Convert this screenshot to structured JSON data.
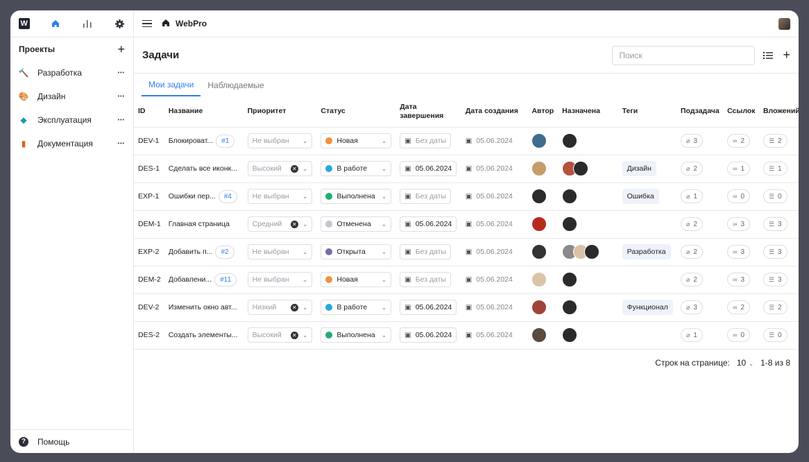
{
  "app": {
    "name": "WebPro",
    "logo_letter": "W"
  },
  "sidebar": {
    "projects_title": "Проекты",
    "items": [
      {
        "label": "Разработка",
        "icon": "hammer-icon",
        "color": "#7a5a2a"
      },
      {
        "label": "Дизайн",
        "icon": "palette-icon",
        "color": "#e0a000"
      },
      {
        "label": "Эксплуатация",
        "icon": "diamond-icon",
        "color": "#1c9aa8"
      },
      {
        "label": "Документация",
        "icon": "book-icon",
        "color": "#e0621e"
      }
    ],
    "help_label": "Помощь"
  },
  "header": {
    "title": "Задачи",
    "search_placeholder": "Поиск"
  },
  "tabs": [
    {
      "label": "Мои задачи",
      "active": true
    },
    {
      "label": "Наблюдаемые",
      "active": false
    }
  ],
  "columns": [
    "ID",
    "Название",
    "Приоритет",
    "Статус",
    "Дата завершения",
    "Дата создания",
    "Автор",
    "Назначена",
    "Теги",
    "Подзадача",
    "Ссылок",
    "Вложений"
  ],
  "rows": [
    {
      "id": "DEV-1",
      "name": "Блокироват...",
      "num": "#1",
      "priority": "Не выбран",
      "priority_set": false,
      "status": "Новая",
      "status_color": "#f0923a",
      "due": "Без даты",
      "due_set": false,
      "created": "05.06.2024",
      "author": [
        "#3f6d8c"
      ],
      "assigned": [
        "#2b2b2b"
      ],
      "tag": "",
      "sub": "3",
      "links": "2",
      "att": "2"
    },
    {
      "id": "DES-1",
      "name": "Сделать все иконк...",
      "num": "",
      "priority": "Высокий",
      "priority_set": true,
      "status": "В работе",
      "status_color": "#2aa8d8",
      "due": "05.06.2024",
      "due_set": true,
      "created": "05.06.2024",
      "author": [
        "#c89b6a"
      ],
      "assigned": [
        "#b5533c",
        "#2b2b2b"
      ],
      "tag": "Дизайн",
      "sub": "2",
      "links": "1",
      "att": "1"
    },
    {
      "id": "EXP-1",
      "name": "Ошибки пер...",
      "num": "#4",
      "priority": "Не выбран",
      "priority_set": false,
      "status": "Выполнена",
      "status_color": "#1fae72",
      "due": "Без даты",
      "due_set": false,
      "created": "05.06.2024",
      "author": [
        "#2b2b2b"
      ],
      "assigned": [
        "#2b2b2b"
      ],
      "tag": "Ошибка",
      "sub": "1",
      "links": "0",
      "att": "0"
    },
    {
      "id": "DEM-1",
      "name": "Главная страница",
      "num": "",
      "priority": "Средний",
      "priority_set": true,
      "status": "Отменена",
      "status_color": "#c2c6d0",
      "due": "05.06.2024",
      "due_set": true,
      "created": "05.06.2024",
      "author": [
        "#b82a1e"
      ],
      "assigned": [
        "#2b2b2b"
      ],
      "tag": "",
      "sub": "2",
      "links": "3",
      "att": "3"
    },
    {
      "id": "EXP-2",
      "name": "Добавить п...",
      "num": "#2",
      "priority": "Не выбран",
      "priority_set": false,
      "status": "Открыта",
      "status_color": "#7a6aa8",
      "due": "Без даты",
      "due_set": false,
      "created": "05.06.2024",
      "author": [
        "#333333"
      ],
      "assigned": [
        "#8a8a8a",
        "#d8c3a8",
        "#2b2b2b"
      ],
      "tag": "Разработка",
      "sub": "2",
      "links": "3",
      "att": "3"
    },
    {
      "id": "DEM-2",
      "name": "Добавлени...",
      "num": "#11",
      "priority": "Не выбран",
      "priority_set": false,
      "status": "Новая",
      "status_color": "#f0923a",
      "due": "Без даты",
      "due_set": false,
      "created": "05.06.2024",
      "author": [
        "#d9c4a8"
      ],
      "assigned": [
        "#2b2b2b"
      ],
      "tag": "",
      "sub": "2",
      "links": "3",
      "att": "3"
    },
    {
      "id": "DEV-2",
      "name": "Изменить окно авт...",
      "num": "",
      "priority": "Низкий",
      "priority_set": true,
      "status": "В работе",
      "status_color": "#2aa8d8",
      "due": "05.06.2024",
      "due_set": true,
      "created": "05.06.2024",
      "author": [
        "#a0443a"
      ],
      "assigned": [
        "#2b2b2b"
      ],
      "tag": "Функционал",
      "sub": "3",
      "links": "2",
      "att": "2"
    },
    {
      "id": "DES-2",
      "name": "Создать элементы...",
      "num": "",
      "priority": "Высокий",
      "priority_set": true,
      "status": "Выполнена",
      "status_color": "#1fae72",
      "due": "05.06.2024",
      "due_set": true,
      "created": "05.06.2024",
      "author": [
        "#5a4a40"
      ],
      "assigned": [
        "#2b2b2b"
      ],
      "tag": "",
      "sub": "1",
      "links": "0",
      "att": "0"
    }
  ],
  "pager": {
    "label": "Строк на странице:",
    "size": "10",
    "range": "1-8 из 8"
  },
  "colors": {
    "accent": "#2f7ef0",
    "frame": "#4a4d57"
  }
}
